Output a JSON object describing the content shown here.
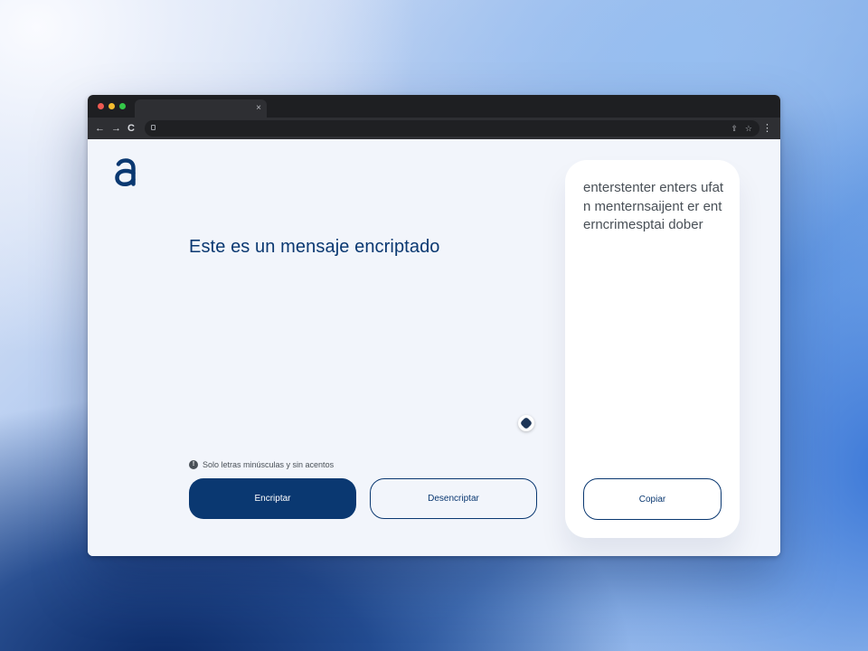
{
  "browser": {
    "tab": {
      "close_label": "×"
    },
    "nav": {
      "back": "←",
      "forward": "→",
      "reload": "C"
    },
    "address": {
      "value": "",
      "share_icon": "⇪",
      "bookmark_icon": "☆"
    },
    "menu_icon": "⋮"
  },
  "app": {
    "logo_icon": "alura-a-logo",
    "message": "Este es un mensaje encriptado",
    "hint": {
      "icon": "!",
      "text": "Solo letras minúsculas y sin acentos"
    },
    "buttons": {
      "encrypt": "Encriptar",
      "decrypt": "Desencriptar"
    },
    "output": {
      "text": "enterstenter enters ufatn menternsaijent er enterncrimesptai dober",
      "copy": "Copiar"
    }
  },
  "colors": {
    "primary": "#0a3871",
    "text_gray": "#495057",
    "background": "#f2f5fb",
    "panel": "#ffffff"
  }
}
